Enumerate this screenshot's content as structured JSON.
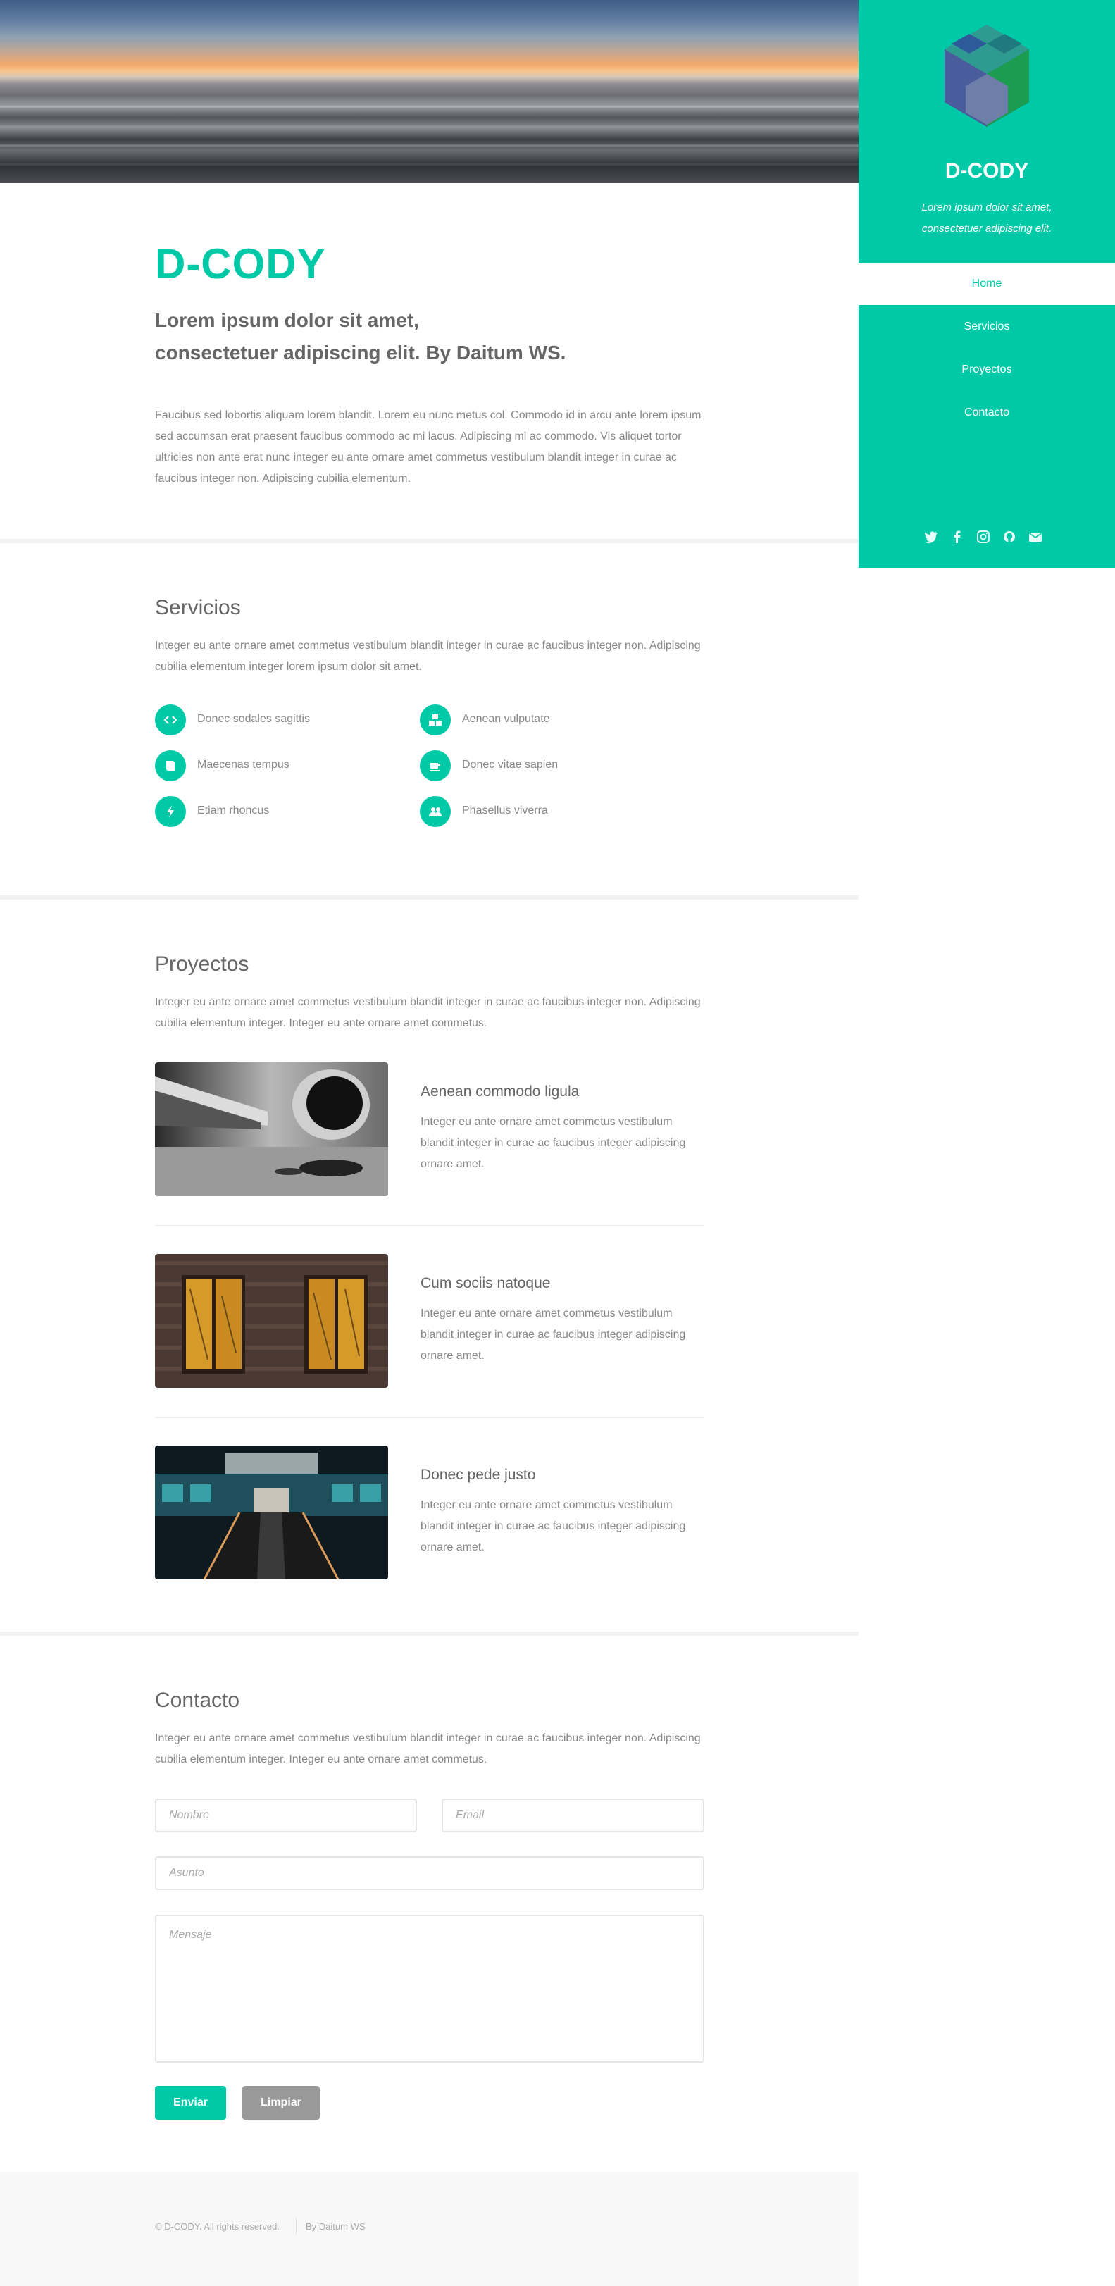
{
  "sidebar": {
    "logo_icon": "cube-hexagon-logo",
    "title": "D-CODY",
    "subtitle": "Lorem ipsum dolor sit amet, consectetuer adipiscing elit.",
    "nav": [
      {
        "label": "Home",
        "active": true
      },
      {
        "label": "Servicios",
        "active": false
      },
      {
        "label": "Proyectos",
        "active": false
      },
      {
        "label": "Contacto",
        "active": false
      }
    ],
    "social_icons": [
      "twitter-icon",
      "facebook-icon",
      "instagram-icon",
      "github-icon",
      "envelope-icon"
    ]
  },
  "intro": {
    "title": "D-CODY",
    "tagline_line1": "Lorem ipsum dolor sit amet,",
    "tagline_line2": "consectetuer adipiscing elit. By Daitum WS.",
    "body": "Faucibus sed lobortis aliquam lorem blandit. Lorem eu nunc metus col. Commodo id in arcu ante lorem ipsum sed accumsan erat praesent faucibus commodo ac mi lacus. Adipiscing mi ac commodo. Vis aliquet tortor ultricies non ante erat nunc integer eu ante ornare amet commetus vestibulum blandit integer in curae ac faucibus integer non. Adipiscing cubilia elementum."
  },
  "services": {
    "title": "Servicios",
    "description": "Integer eu ante ornare amet commetus vestibulum blandit integer in curae ac faucibus integer non. Adipiscing cubilia elementum integer lorem ipsum dolor sit amet.",
    "items": [
      {
        "label": "Donec sodales sagittis",
        "icon": "code-icon"
      },
      {
        "label": "Aenean vulputate",
        "icon": "cubes-icon"
      },
      {
        "label": "Maecenas tempus",
        "icon": "book-icon"
      },
      {
        "label": "Donec vitae sapien",
        "icon": "coffee-icon"
      },
      {
        "label": "Etiam rhoncus",
        "icon": "bolt-icon"
      },
      {
        "label": "Phasellus viverra",
        "icon": "users-icon"
      }
    ]
  },
  "projects": {
    "title": "Proyectos",
    "description": "Integer eu ante ornare amet commetus vestibulum blandit integer in curae ac faucibus integer non. Adipiscing cubilia elementum integer. Integer eu ante ornare amet commetus.",
    "items": [
      {
        "title": "Aenean commodo ligula",
        "description": "Integer eu ante ornare amet commetus vestibulum blandit integer in curae ac faucibus integer adipiscing ornare amet.",
        "image": "jet-engine-photo"
      },
      {
        "title": "Cum sociis natoque",
        "description": "Integer eu ante ornare amet commetus vestibulum blandit integer in curae ac faucibus integer adipiscing ornare amet.",
        "image": "brick-windows-photo"
      },
      {
        "title": "Donec pede justo",
        "description": "Integer eu ante ornare amet commetus vestibulum blandit integer in curae ac faucibus integer adipiscing ornare amet.",
        "image": "escalator-station-photo"
      }
    ]
  },
  "contact": {
    "title": "Contacto",
    "description": "Integer eu ante ornare amet commetus vestibulum blandit integer in curae ac faucibus integer non. Adipiscing cubilia elementum integer. Integer eu ante ornare amet commetus.",
    "name_placeholder": "Nombre",
    "email_placeholder": "Email",
    "subject_placeholder": "Asunto",
    "message_placeholder": "Mensaje",
    "send_label": "Enviar",
    "clear_label": "Limpiar"
  },
  "footer": {
    "copyright": "© D-CODY. All rights reserved.",
    "credit": "By Daitum WS"
  },
  "colors": {
    "accent": "#00c9a7",
    "clear_button": "#999999",
    "text": "#777777"
  }
}
